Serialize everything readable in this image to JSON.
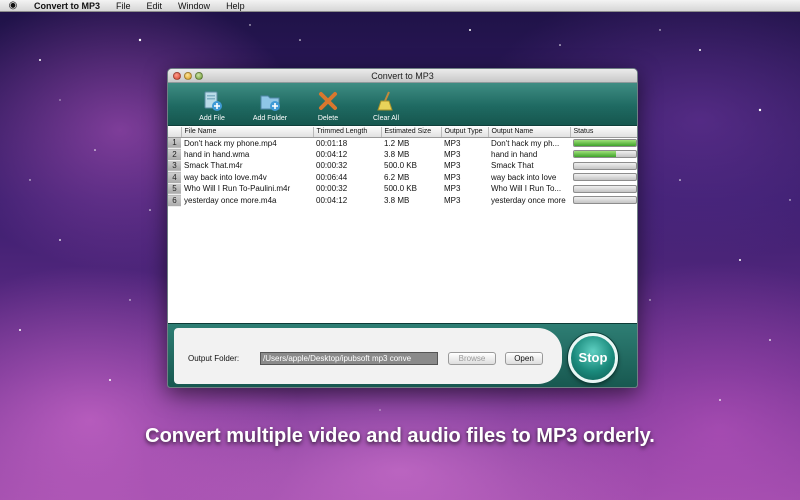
{
  "menubar": {
    "app_name": "Convert to MP3",
    "items": [
      "File",
      "Edit",
      "Window",
      "Help"
    ]
  },
  "window": {
    "title": "Convert to MP3"
  },
  "toolbar": {
    "buttons": [
      {
        "label": "Add File",
        "icon": "add-file-icon"
      },
      {
        "label": "Add Folder",
        "icon": "add-folder-icon"
      },
      {
        "label": "Delete",
        "icon": "delete-icon"
      },
      {
        "label": "Clear All",
        "icon": "broom-icon"
      }
    ]
  },
  "table": {
    "headers": [
      "File Name",
      "Trimmed Length",
      "Estimated Size",
      "Output Type",
      "Output Name",
      "Status"
    ],
    "rows": [
      {
        "index": "1",
        "file": "Don't hack my phone.mp4",
        "length": "00:01:18",
        "size": "1.2 MB",
        "type": "MP3",
        "output": "Don't hack my ph...",
        "progress": 1.0
      },
      {
        "index": "2",
        "file": "hand in hand.wma",
        "length": "00:04:12",
        "size": "3.8 MB",
        "type": "MP3",
        "output": "hand in hand",
        "progress": 0.68
      },
      {
        "index": "3",
        "file": "Smack That.m4r",
        "length": "00:00:32",
        "size": "500.0 KB",
        "type": "MP3",
        "output": "Smack That",
        "progress": 0
      },
      {
        "index": "4",
        "file": "way back into love.m4v",
        "length": "00:06:44",
        "size": "6.2 MB",
        "type": "MP3",
        "output": "way back into love",
        "progress": 0
      },
      {
        "index": "5",
        "file": "Who Will I Run To-Paulini.m4r",
        "length": "00:00:32",
        "size": "500.0 KB",
        "type": "MP3",
        "output": "Who Will I Run To...",
        "progress": 0
      },
      {
        "index": "6",
        "file": "yesterday once more.m4a",
        "length": "00:04:12",
        "size": "3.8 MB",
        "type": "MP3",
        "output": "yesterday once more",
        "progress": 0
      }
    ]
  },
  "bottom": {
    "output_folder_label": "Output Folder:",
    "output_folder_value": "/Users/apple/Desktop/ipubsoft mp3 conve",
    "browse_label": "Browse",
    "open_label": "Open",
    "stop_label": "Stop"
  },
  "caption": "Convert multiple video and audio files to MP3 orderly.",
  "colors": {
    "toolbar": "#1f6a62",
    "progress": "#3fa32a",
    "stop_button": "#1a8a7c"
  }
}
